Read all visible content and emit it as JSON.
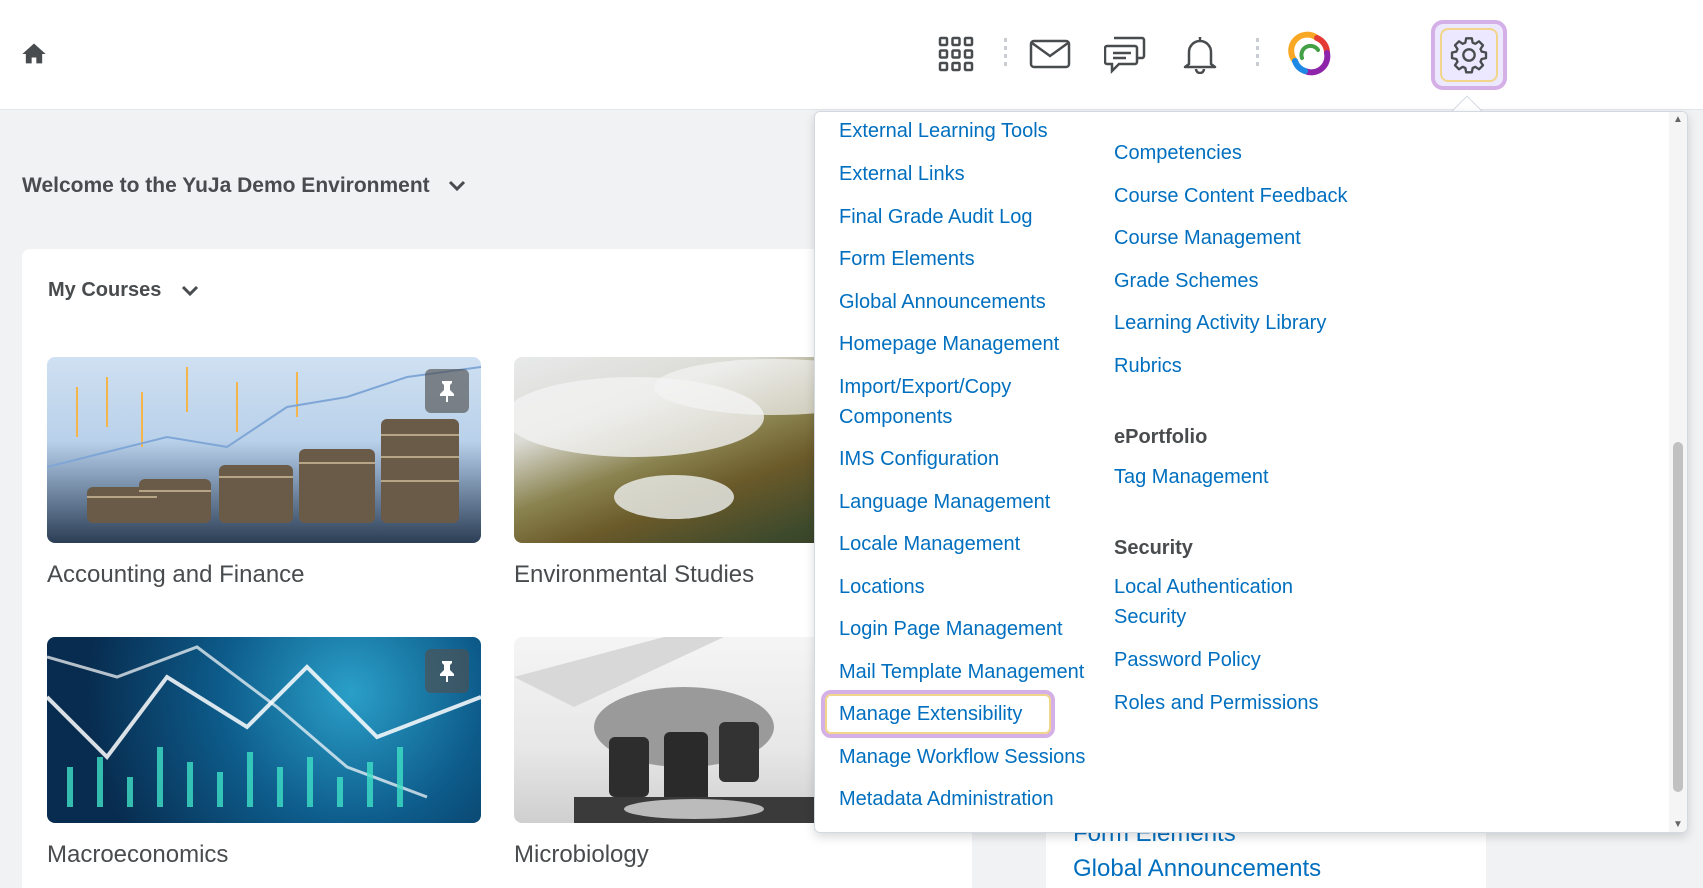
{
  "header": {
    "icons": [
      "home-icon",
      "apps-grid-icon",
      "mail-icon",
      "chat-icon",
      "bell-icon",
      "yuja-logo-icon",
      "gear-icon"
    ]
  },
  "welcome": {
    "title": "Welcome to the YuJa Demo Environment"
  },
  "courses": {
    "title": "My Courses",
    "tiles": [
      {
        "name": "Accounting and Finance"
      },
      {
        "name": "Environmental Studies"
      },
      {
        "name": "Macroeconomics"
      },
      {
        "name": "Microbiology"
      }
    ]
  },
  "dropdown": {
    "col1": [
      "External Learning Tools",
      "External Links",
      "Final Grade Audit Log",
      "Form Elements",
      "Global Announcements",
      "Homepage Management",
      "Import/Export/Copy",
      "Components",
      "IMS Configuration",
      "Language Management",
      "Locale Management",
      "Locations",
      "Login Page Management",
      "Mail Template Management",
      "Manage Extensibility",
      "Manage Workflow Sessions",
      "Metadata Administration"
    ],
    "col2_top": [
      "Competencies",
      "Course Content Feedback",
      "Course Management",
      "Grade Schemes",
      "Learning Activity Library",
      "Rubrics"
    ],
    "eportfolio": {
      "heading": "ePortfolio",
      "items": [
        "Tag Management"
      ]
    },
    "security": {
      "heading": "Security",
      "items": [
        "Local Authentication",
        "Security",
        "Password Policy",
        "Roles and Permissions"
      ]
    }
  },
  "behind": {
    "links": [
      "Form Elements",
      "Global Announcements"
    ]
  },
  "colors": {
    "link": "#006fbf",
    "highlight_border": "#d4b0e6",
    "highlight_fill": "#ece8ff"
  }
}
